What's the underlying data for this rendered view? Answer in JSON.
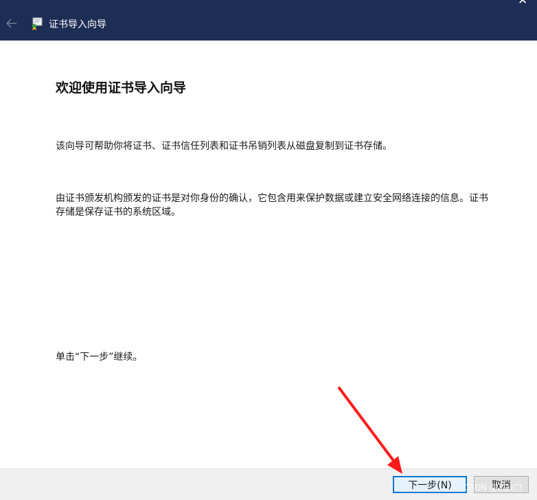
{
  "window": {
    "title": "证书导入向导",
    "close_glyph": "✕",
    "back_icon": "back-arrow-icon",
    "app_icon": "certificate-icon"
  },
  "main": {
    "heading": "欢迎使用证书导入向导",
    "paragraph1": "该向导可帮助你将证书、证书信任列表和证书吊销列表从磁盘复制到证书存储。",
    "paragraph2": "由证书颁发机构颁发的证书是对你身份的确认，它包含用来保护数据或建立安全网络连接的信息。证书存储是保存证书的系统区域。",
    "paragraph3": "单击“下一步”继续。"
  },
  "footer": {
    "next_label": "下一步(N)",
    "cancel_label": "取消"
  },
  "watermark": "CSDN @ZDICT",
  "colors": {
    "titlebar": "#1d2e55",
    "accent": "#0078d7",
    "annotation_arrow": "#ff1a1a"
  }
}
